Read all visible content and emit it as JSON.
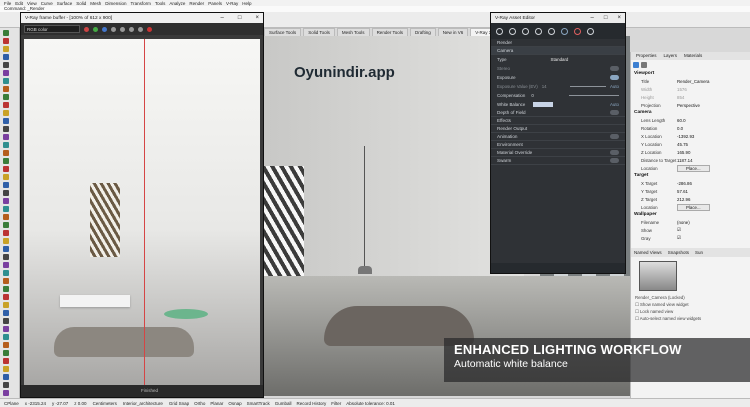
{
  "menu": [
    "File",
    "Edit",
    "View",
    "Curve",
    "Surface",
    "Solid",
    "Mesh",
    "Dimension",
    "Transform",
    "Tools",
    "Analyze",
    "Render",
    "Panels",
    "V-Ray",
    "Help"
  ],
  "command": "Command: _Render",
  "viewport_tabs": [
    "Surface Tools",
    "Solid Tools",
    "Mesh Tools",
    "Render Tools",
    "Drafting",
    "New in V6",
    "V-Ray 3(A)"
  ],
  "watermark": "Oyunindir.app",
  "vfb": {
    "title": "V-Ray frame buffer - [100% of 612 x 900]",
    "channel": "RGB color",
    "status": "Finished"
  },
  "asset_editor": {
    "title": "V-Ray Asset Editor",
    "sections": {
      "render": "Render",
      "camera": "Camera",
      "dof": "Depth of Field",
      "effects": "Effects",
      "render_output": "Render Output",
      "animation": "Animation",
      "environment": "Environment",
      "material_override": "Material Override",
      "swarm": "Swarm"
    },
    "rows": {
      "type_label": "Type",
      "type_value": "Standard",
      "stereo_label": "Stereo",
      "exposure_label": "Exposure",
      "exposure_value_label": "Exposure Value (EV)",
      "exposure_value": "14",
      "auto1": "Auto",
      "compensation_label": "Compensation",
      "compensation_value": "0",
      "white_balance_label": "White Balance",
      "auto2": "Auto"
    }
  },
  "properties": {
    "tabs": [
      "Properties",
      "Layers",
      "Materials"
    ],
    "viewport_header": "Viewport",
    "viewport_rows": [
      {
        "k": "Title",
        "v": "Render_Camera"
      },
      {
        "k": "Width",
        "v": "1576",
        "dim": true
      },
      {
        "k": "Height",
        "v": "854",
        "dim": true
      },
      {
        "k": "Projection",
        "v": "Perspective"
      }
    ],
    "camera_header": "Camera",
    "camera_rows": [
      {
        "k": "Lens Length",
        "v": "60.0"
      },
      {
        "k": "Rotation",
        "v": "0.0"
      },
      {
        "k": "X Location",
        "v": "-1392.93"
      },
      {
        "k": "Y Location",
        "v": "45.75"
      },
      {
        "k": "Z Location",
        "v": "165.90"
      },
      {
        "k": "Distance to Target",
        "v": "1187.14"
      }
    ],
    "camera_place": {
      "k": "Location",
      "v": "Place..."
    },
    "target_header": "Target",
    "target_rows": [
      {
        "k": "X Target",
        "v": "-286.86"
      },
      {
        "k": "Y Target",
        "v": "57.61"
      },
      {
        "k": "Z Target",
        "v": "212.96"
      }
    ],
    "target_place": {
      "k": "Location",
      "v": "Place..."
    },
    "wallpaper_header": "Wallpaper",
    "wallpaper_rows": [
      {
        "k": "Filename",
        "v": "(none)"
      },
      {
        "k": "Show",
        "v": "☑"
      },
      {
        "k": "Gray",
        "v": "☑"
      }
    ],
    "nv_tabs": [
      "Named Views",
      "Snapshots",
      "Sun"
    ],
    "nv_item": "Render_Camera (Locked)",
    "nv_options": [
      "Show named view widget",
      "Lock named view",
      "Auto-select named view widgets"
    ]
  },
  "banner": {
    "headline": "ENHANCED LIGHTING WORKFLOW",
    "sub": "Automatic white balance"
  },
  "statusbar": {
    "plane": "CPlane",
    "x": "x -2315.24",
    "y": "y -27.07",
    "z": "z 0.00",
    "units": "Centimeters",
    "layer": "Interior_architecture",
    "items": [
      "Grid Snap",
      "Ortho",
      "Planar",
      "Osnap",
      "SmartTrack",
      "Gumball",
      "Record History",
      "Filter",
      "Absolute tolerance: 0.01"
    ]
  },
  "colors": {
    "accent": "#3c7fd1",
    "ae_bg": "#2f3236",
    "vfb_line": "#d54545"
  }
}
